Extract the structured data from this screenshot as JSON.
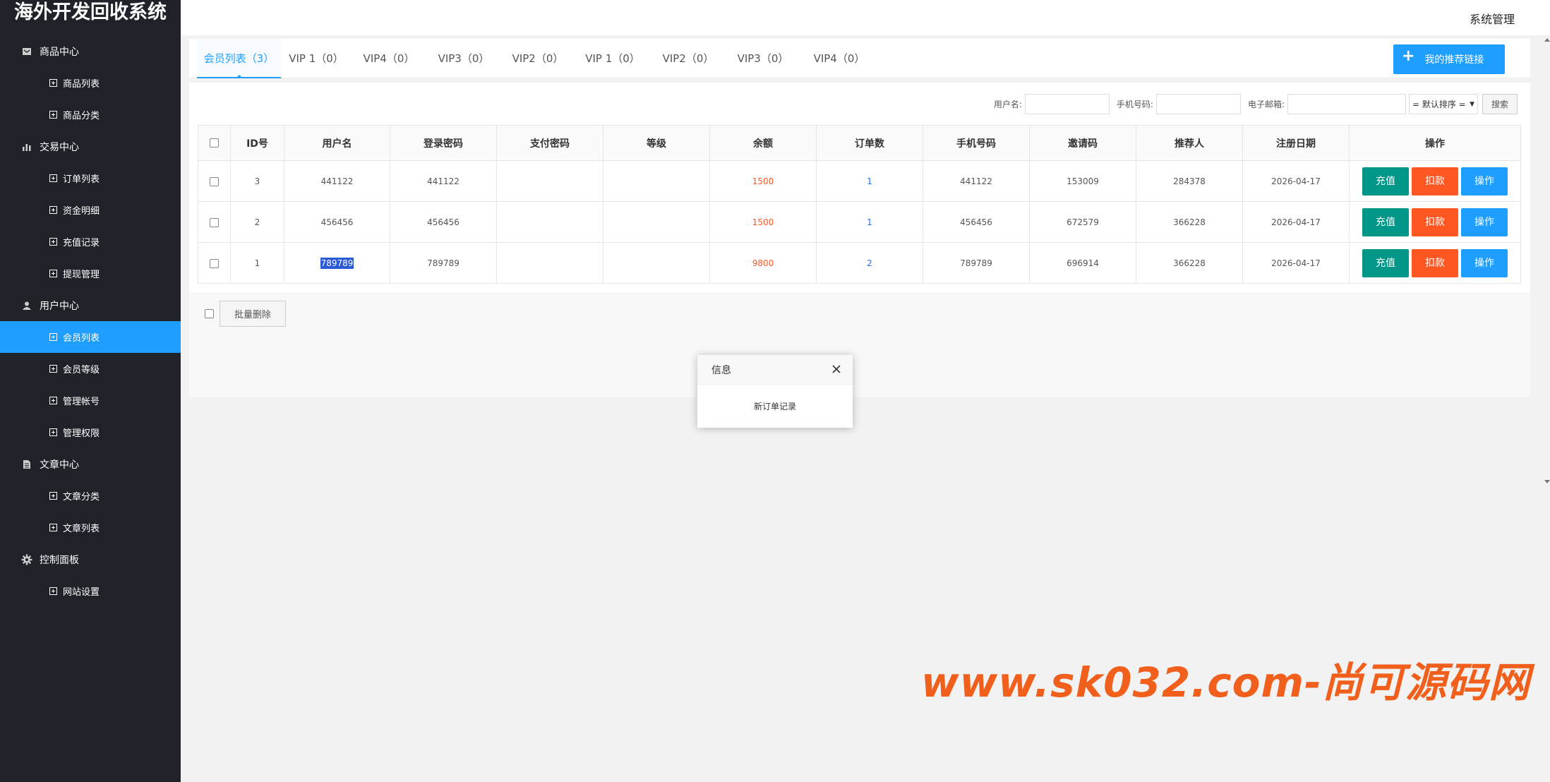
{
  "app": {
    "title": "海外开发回收系统",
    "top_right": "系统管理"
  },
  "sidebar": {
    "groups": [
      {
        "label": "商品中心",
        "icon": "box-icon",
        "items": [
          {
            "label": "商品列表"
          },
          {
            "label": "商品分类"
          }
        ]
      },
      {
        "label": "交易中心",
        "icon": "bar-chart-icon",
        "items": [
          {
            "label": "订单列表"
          },
          {
            "label": "资金明细"
          },
          {
            "label": "充值记录"
          },
          {
            "label": "提现管理"
          }
        ]
      },
      {
        "label": "用户中心",
        "icon": "user-icon",
        "items": [
          {
            "label": "会员列表"
          },
          {
            "label": "会员等级"
          },
          {
            "label": "管理帐号"
          },
          {
            "label": "管理权限"
          }
        ]
      },
      {
        "label": "文章中心",
        "icon": "document-icon",
        "items": [
          {
            "label": "文章分类"
          },
          {
            "label": "文章列表"
          }
        ]
      },
      {
        "label": "控制面板",
        "icon": "gear-icon",
        "items": [
          {
            "label": "网站设置"
          }
        ]
      }
    ],
    "active": "会员列表"
  },
  "tabs": [
    {
      "label": "会员列表（3）"
    },
    {
      "label": "VIP 1（0）"
    },
    {
      "label": "VIP4（0）"
    },
    {
      "label": "VIP3（0）"
    },
    {
      "label": "VIP2（0）"
    },
    {
      "label": "VIP 1（0）"
    },
    {
      "label": "VIP2（0）"
    },
    {
      "label": "VIP3（0）"
    },
    {
      "label": "VIP4（0）"
    }
  ],
  "recommend_button": "我的推荐链接",
  "search": {
    "username_label": "用户名:",
    "phone_label": "手机号码:",
    "email_label": "电子邮箱:",
    "sort_value": "= 默认排序 =",
    "search_button": "搜索"
  },
  "table": {
    "headers": [
      "ID号",
      "用户名",
      "登录密码",
      "支付密码",
      "等级",
      "余额",
      "订单数",
      "手机号码",
      "邀请码",
      "推荐人",
      "注册日期",
      "操作"
    ],
    "rows": [
      {
        "id": "3",
        "username": "441122",
        "login_pwd": "441122",
        "pay_pwd": "",
        "level": "",
        "balance": "1500",
        "orders": "1",
        "phone": "441122",
        "invite": "153009",
        "referrer": "284378",
        "date": "2026-04-17"
      },
      {
        "id": "2",
        "username": "456456",
        "login_pwd": "456456",
        "pay_pwd": "",
        "level": "",
        "balance": "1500",
        "orders": "1",
        "phone": "456456",
        "invite": "672579",
        "referrer": "366228",
        "date": "2026-04-17"
      },
      {
        "id": "1",
        "username": "789789",
        "login_pwd": "789789",
        "pay_pwd": "",
        "level": "",
        "balance": "9800",
        "orders": "2",
        "phone": "789789",
        "invite": "696914",
        "referrer": "366228",
        "date": "2026-04-17"
      }
    ],
    "actions": {
      "recharge": "充值",
      "deduct": "扣款",
      "operate": "操作"
    }
  },
  "batch_delete": "批量删除",
  "dialog": {
    "title": "信息",
    "message": "新订单记录"
  },
  "watermark": "www.sk032.com-尚可源码网",
  "colors": {
    "sidebar_bg": "#20222a",
    "accent": "#1e9fff",
    "green": "#009688",
    "orange": "#ff5722",
    "watermark": "#f0601c"
  }
}
